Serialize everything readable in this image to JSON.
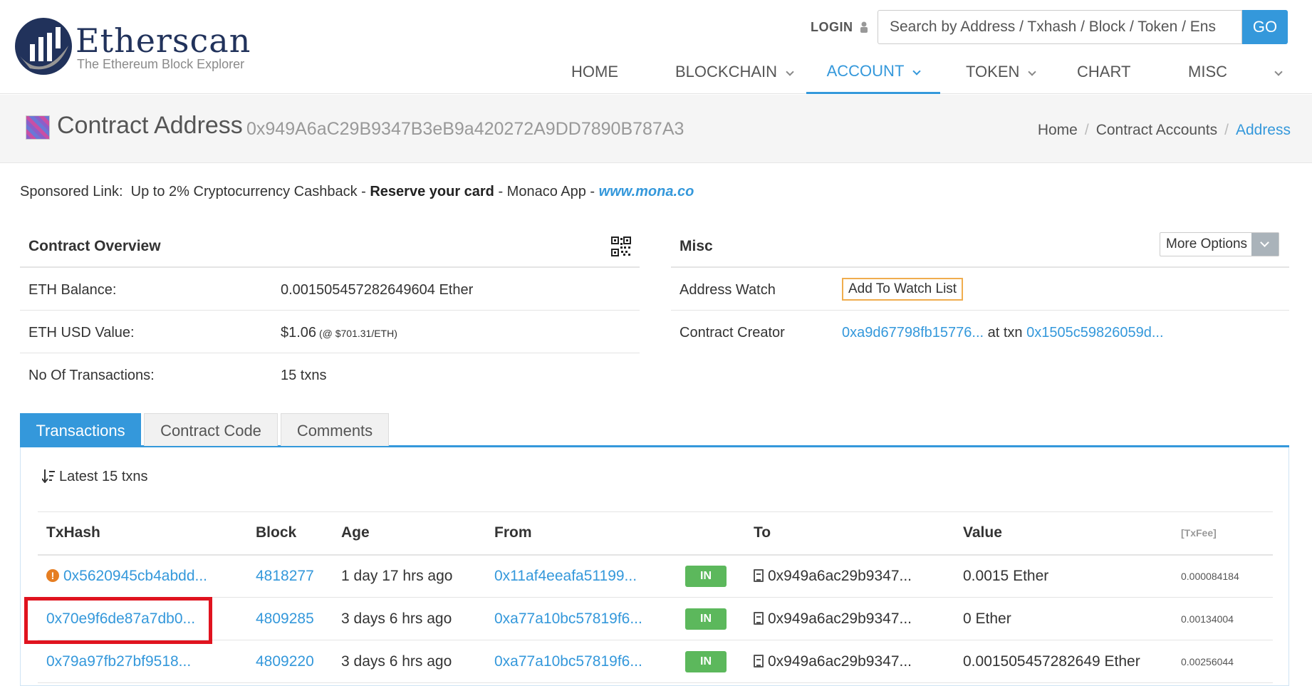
{
  "header": {
    "logo_name": "Etherscan",
    "logo_tagline": "The Ethereum Block Explorer",
    "login_label": "LOGIN",
    "search_placeholder": "Search by Address / Txhash / Block / Token / Ens",
    "go_label": "GO",
    "nav": [
      {
        "label": "HOME"
      },
      {
        "label": "BLOCKCHAIN"
      },
      {
        "label": "ACCOUNT"
      },
      {
        "label": "TOKEN"
      },
      {
        "label": "CHART"
      },
      {
        "label": "MISC"
      }
    ]
  },
  "title_band": {
    "title": "Contract Address",
    "address": "0x949A6aC29B9347B3eB9a420272A9DD7890B787A3",
    "breadcrumb": [
      "Home",
      "Contract Accounts",
      "Address"
    ]
  },
  "sponsored": {
    "label": "Sponsored Link:",
    "text1": "Up to 2% Cryptocurrency Cashback - ",
    "bold": "Reserve your card",
    "text2": " - Monaco App - ",
    "url": "www.mona.co"
  },
  "overview": {
    "heading": "Contract Overview",
    "rows": [
      {
        "label": "ETH Balance:",
        "value": "0.001505457282649604 Ether",
        "extra": ""
      },
      {
        "label": "ETH USD Value:",
        "value": "$1.06",
        "extra": " (@ $701.31/ETH)"
      },
      {
        "label": "No Of Transactions:",
        "value": "15 txns",
        "extra": ""
      }
    ]
  },
  "misc": {
    "heading": "Misc",
    "more_options_label": "More Options",
    "address_watch_label": "Address Watch",
    "watch_button": "Add To Watch List",
    "creator_label": "Contract Creator",
    "creator_address": "0xa9d67798fb15776...",
    "at_txn": " at txn ",
    "creator_txn": "0x1505c59826059d..."
  },
  "tabs": [
    {
      "label": "Transactions"
    },
    {
      "label": "Contract Code"
    },
    {
      "label": "Comments"
    }
  ],
  "txns": {
    "latest_label": "Latest 15 txns",
    "columns": {
      "txhash": "TxHash",
      "block": "Block",
      "age": "Age",
      "from": "From",
      "to": "To",
      "value": "Value",
      "fee": "[TxFee]"
    },
    "rows": [
      {
        "hash": "0x5620945cb4abdd...",
        "block": "4818277",
        "age": "1 day 17 hrs ago",
        "from": "0x11af4eeafa51199...",
        "direction": "IN",
        "to": "0x949a6ac29b9347...",
        "value": "0.0015 Ether",
        "fee": "0.000084184"
      },
      {
        "hash": "0x70e9f6de87a7db0...",
        "block": "4809285",
        "age": "3 days 6 hrs ago",
        "from": "0xa77a10bc57819f6...",
        "direction": "IN",
        "to": "0x949a6ac29b9347...",
        "value": "0 Ether",
        "fee": "0.00134004"
      },
      {
        "hash": "0x79a97fb27bf9518...",
        "block": "4809220",
        "age": "3 days 6 hrs ago",
        "from": "0xa77a10bc57819f6...",
        "direction": "IN",
        "to": "0x949a6ac29b9347...",
        "value": "0.001505457282649 Ether",
        "fee": "0.00256044"
      }
    ]
  },
  "colors": {
    "accent": "#3498db",
    "in_badge": "#5cb85c",
    "highlight": "#e0131f",
    "warning": "#e67e22"
  }
}
